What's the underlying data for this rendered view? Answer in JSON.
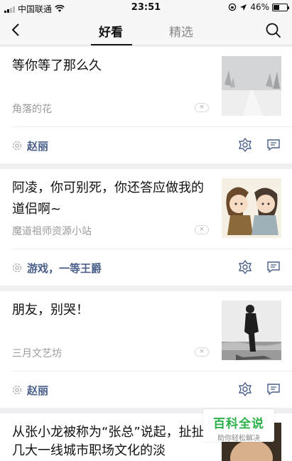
{
  "status_bar": {
    "carrier": "中国联通",
    "time": "23:51",
    "battery": "46%",
    "battery_level": 0.46
  },
  "header": {
    "tabs": [
      {
        "label": "好看",
        "active": true
      },
      {
        "label": "精选",
        "active": false
      }
    ]
  },
  "feed": [
    {
      "title": "等你等了那么久",
      "source": "角落的花",
      "author": "赵丽",
      "dismiss": "×",
      "thumb_desc": "snowy-road-photo"
    },
    {
      "title": "阿凌，你可别死，你还答应做我的道侣啊~",
      "source": "魔道祖师资源小站",
      "author": "游戏，一等王爵",
      "dismiss": "×",
      "thumb_desc": "anime-couple-illustration"
    },
    {
      "title": "朋友，别哭！",
      "source": "三月文艺坊",
      "author": "赵丽",
      "dismiss": "×",
      "thumb_desc": "person-at-beach-bw-photo"
    },
    {
      "title": "从张小龙被称为“张总”说起，扯扯几大一线城市职场文化的淡",
      "title_line1": "从张小龙被称为“张总”说起，扯扯",
      "title_line2": "几大一线城市职场文化的淡",
      "thumb_desc": "person-portrait-photo"
    }
  ],
  "overlay": {
    "title": "百科全说",
    "subtitle": "助你轻松解决"
  },
  "colors": {
    "author_link": "#4a5f8a",
    "background": "#efeff4",
    "overlay_green": "#2bb04a"
  }
}
